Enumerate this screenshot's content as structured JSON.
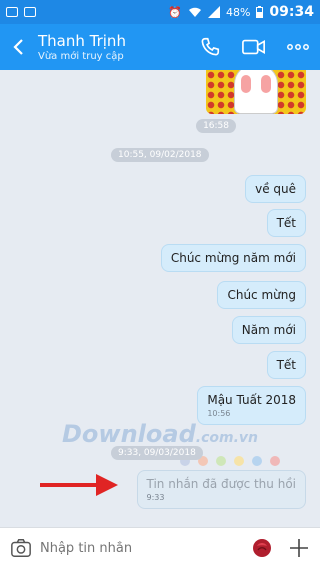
{
  "status_bar": {
    "battery": "48%",
    "time": "09:34"
  },
  "header": {
    "title": "Thanh Trịnh",
    "subtitle": "Vừa mới truy cập"
  },
  "chat": {
    "sticker_time": "16:58",
    "date_divider_1": "10:55, 09/02/2018",
    "messages": [
      {
        "text": "về quê"
      },
      {
        "text": "Tết"
      },
      {
        "text": "Chúc mừng năm mới"
      },
      {
        "text": "Chúc mừng"
      },
      {
        "text": "Năm mới"
      },
      {
        "text": "Tết"
      },
      {
        "text": "Mậu Tuất 2018",
        "time": "10:56"
      }
    ],
    "date_divider_2": "9:33, 09/03/2018",
    "recalled": {
      "text": "Tin nhắn đã được thu hồi",
      "time": "9:33"
    }
  },
  "watermark": {
    "main": "Download",
    "suffix": ".com.vn"
  },
  "input": {
    "placeholder": "Nhập tin nhắn"
  },
  "colors": {
    "accent": "#2196f3",
    "bubble": "#d5ecfb",
    "arrow": "#e02424"
  }
}
